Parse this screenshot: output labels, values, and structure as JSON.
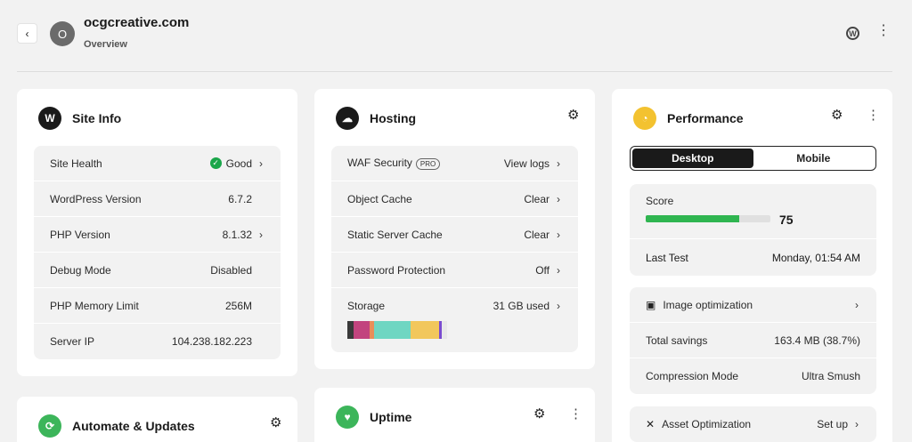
{
  "header": {
    "back_icon": "‹",
    "avatar_letter": "O",
    "site_name": "ocgcreative.com",
    "subtitle": "Overview"
  },
  "site_info": {
    "title": "Site Info",
    "rows": [
      {
        "label": "Site Health",
        "value": "Good"
      },
      {
        "label": "WordPress Version",
        "value": "6.7.2"
      },
      {
        "label": "PHP Version",
        "value": "8.1.32"
      },
      {
        "label": "Debug Mode",
        "value": "Disabled"
      },
      {
        "label": "PHP Memory Limit",
        "value": "256M"
      },
      {
        "label": "Server IP",
        "value": "104.238.182.223"
      }
    ]
  },
  "hosting": {
    "title": "Hosting",
    "rows": [
      {
        "label": "WAF Security",
        "badge": "PRO",
        "value": "View logs"
      },
      {
        "label": "Object Cache",
        "value": "Clear"
      },
      {
        "label": "Static Server Cache",
        "value": "Clear"
      },
      {
        "label": "Password Protection",
        "value": "Off"
      },
      {
        "label": "Storage",
        "value": "31 GB used"
      }
    ],
    "storage_segments": [
      {
        "color": "#3a3a3a",
        "fraction": 0.06
      },
      {
        "color": "#c2447e",
        "fraction": 0.16
      },
      {
        "color": "#e88e5a",
        "fraction": 0.05
      },
      {
        "color": "#6fd6c2",
        "fraction": 0.36
      },
      {
        "color": "#f2c75c",
        "fraction": 0.29
      },
      {
        "color": "#7a4bd0",
        "fraction": 0.03
      },
      {
        "color": "#e8e8e8",
        "fraction": 0.05
      }
    ]
  },
  "performance": {
    "title": "Performance",
    "tabs": [
      "Desktop",
      "Mobile"
    ],
    "score_label": "Score",
    "score": "75",
    "score_fraction": 0.75,
    "last_test_label": "Last Test",
    "last_test_value": "Monday, 01:54 AM",
    "image_opt_label": "Image optimization",
    "total_savings_label": "Total savings",
    "total_savings_value": "163.4 MB (38.7%)",
    "compression_label": "Compression Mode",
    "compression_value": "Ultra Smush",
    "asset_opt_label": "Asset Optimization",
    "asset_opt_action": "Set up"
  },
  "automate": {
    "title": "Automate & Updates"
  },
  "uptime": {
    "title": "Uptime"
  },
  "colors": {
    "accent_green": "#2fb550",
    "link_blue": "#1e6fd9",
    "perf_yellow": "#f3c230",
    "uptime_green": "#3cb55a"
  }
}
